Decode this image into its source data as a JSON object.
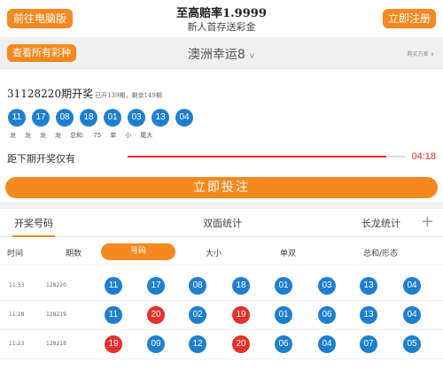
{
  "header": {
    "left_button": "前往电脑版",
    "title": "至高赔率1.9999",
    "subtitle": "新人首存送彩金",
    "right_button": "立即注册"
  },
  "selector": {
    "all_button": "查看所有彩种",
    "lottery_name": "澳洲幸运8",
    "lottery_chevron": "∨",
    "mini_select": "购买方案",
    "mini_chevron": "∨"
  },
  "draw": {
    "title": "31128220期开奖",
    "meta": "已开139期，剩余149期",
    "balls": [
      "11",
      "17",
      "08",
      "18",
      "01",
      "03",
      "13",
      "04"
    ],
    "attrs": [
      "龙",
      "龙",
      "龙",
      "龙",
      "总和:",
      "75",
      "单",
      "小",
      "尾大"
    ]
  },
  "countdown": {
    "label": "距下期开奖仅有",
    "time": "04:18",
    "progress": 0.93
  },
  "bet_button": "立即投注",
  "tabs": [
    "开奖号码",
    "双面统计",
    "长龙统计"
  ],
  "plus_icon": "+",
  "subtabs": [
    "时间",
    "期数",
    "号码",
    "大小",
    "单双",
    "总和/形态"
  ],
  "history": [
    {
      "time": "11:33",
      "issue": "128220",
      "balls": [
        {
          "n": "11",
          "c": "blue"
        },
        {
          "n": "17",
          "c": "blue"
        },
        {
          "n": "08",
          "c": "blue"
        },
        {
          "n": "18",
          "c": "blue"
        },
        {
          "n": "01",
          "c": "blue"
        },
        {
          "n": "03",
          "c": "blue"
        },
        {
          "n": "13",
          "c": "blue"
        },
        {
          "n": "04",
          "c": "blue"
        }
      ]
    },
    {
      "time": "11:28",
      "issue": "128219",
      "balls": [
        {
          "n": "11",
          "c": "blue"
        },
        {
          "n": "20",
          "c": "red"
        },
        {
          "n": "02",
          "c": "blue"
        },
        {
          "n": "19",
          "c": "red"
        },
        {
          "n": "01",
          "c": "blue"
        },
        {
          "n": "06",
          "c": "blue"
        },
        {
          "n": "13",
          "c": "blue"
        },
        {
          "n": "04",
          "c": "blue"
        }
      ]
    },
    {
      "time": "11:23",
      "issue": "128218",
      "balls": [
        {
          "n": "19",
          "c": "red"
        },
        {
          "n": "09",
          "c": "blue"
        },
        {
          "n": "12",
          "c": "blue"
        },
        {
          "n": "20",
          "c": "red"
        },
        {
          "n": "06",
          "c": "blue"
        },
        {
          "n": "04",
          "c": "blue"
        },
        {
          "n": "07",
          "c": "blue"
        },
        {
          "n": "05",
          "c": "blue"
        }
      ]
    }
  ],
  "colors": {
    "accent": "#f5891f",
    "blue_ball": "#1f7fcf",
    "red_ball": "#e4302b"
  }
}
